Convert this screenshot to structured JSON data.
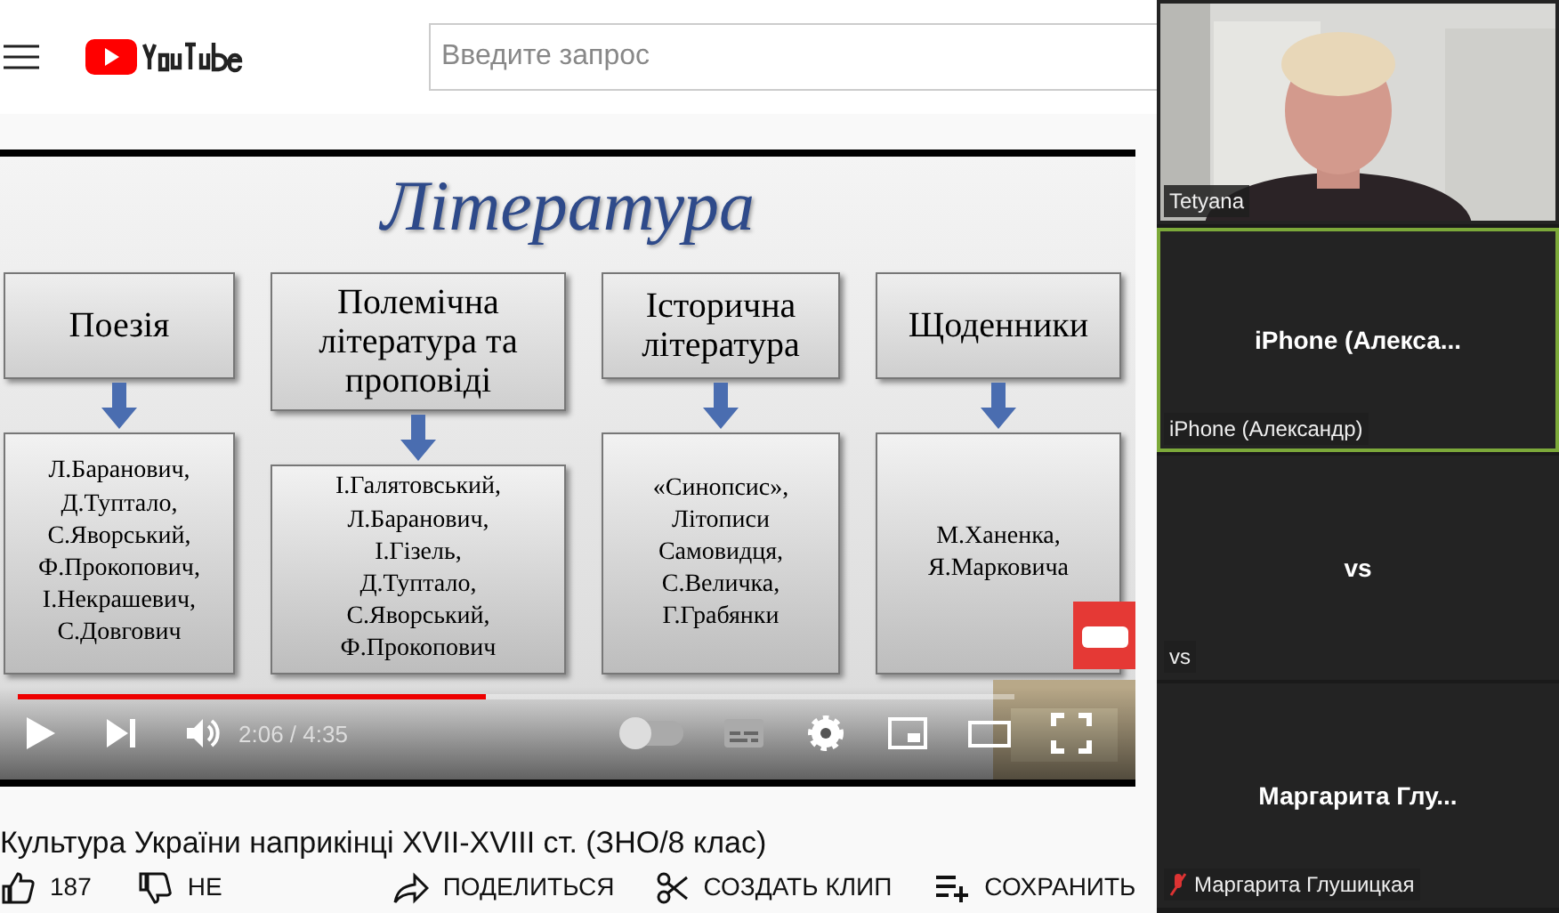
{
  "header": {
    "search": {
      "placeholder": "Введите запрос"
    }
  },
  "video": {
    "slide": {
      "title": "Література",
      "columns": [
        {
          "heading": "Поезія",
          "items": [
            "Л.Баранович,",
            "Д.Туптало,",
            "С.Яворський,",
            "Ф.Прокопович,",
            "І.Некрашевич,",
            "С.Довгович"
          ]
        },
        {
          "heading": "Полемічна література та проповіді",
          "items": [
            "І.Галятовський,",
            "Л.Баранович,",
            "І.Гізель,",
            "Д.Туптало,",
            "С.Яворський,",
            "Ф.Прокопович"
          ]
        },
        {
          "heading": "Історична література",
          "items": [
            "«Синопсис»,",
            "Літописи",
            "Самовидця,",
            "С.Величка,",
            "Г.Грабянки"
          ]
        },
        {
          "heading": "Щоденники",
          "items": [
            "М.Ханенка,",
            "Я.Марковича"
          ]
        }
      ]
    },
    "progress": {
      "level": 0.47
    },
    "time": "2:06 / 4:35",
    "autoplay": {
      "on": false
    }
  },
  "title": "Культура України наприкінці XVII-XVIII ст. (ЗНО/8 клас)",
  "actions": [
    {
      "kind": "like",
      "label": "187"
    },
    {
      "kind": "dislike",
      "label": "НЕ"
    },
    {
      "kind": "share",
      "label": "ПОДЕЛИТЬСЯ"
    },
    {
      "kind": "clip",
      "label": "СОЗДАТЬ КЛИП"
    },
    {
      "kind": "save",
      "label": "СОХРАНИТЬ"
    }
  ],
  "participants": [
    {
      "kind": "video",
      "label": "Tetyana",
      "active": false,
      "muted": false
    },
    {
      "kind": "name",
      "display": "iPhone  (Алекса...",
      "label": "iPhone (Александр)",
      "active": true,
      "muted": false
    },
    {
      "kind": "name",
      "display": "vs",
      "label": "vs",
      "active": false,
      "muted": false
    },
    {
      "kind": "name",
      "display": "Маргарита  Глу...",
      "label": "Маргарита Глушицкая",
      "active": false,
      "muted": true
    }
  ]
}
